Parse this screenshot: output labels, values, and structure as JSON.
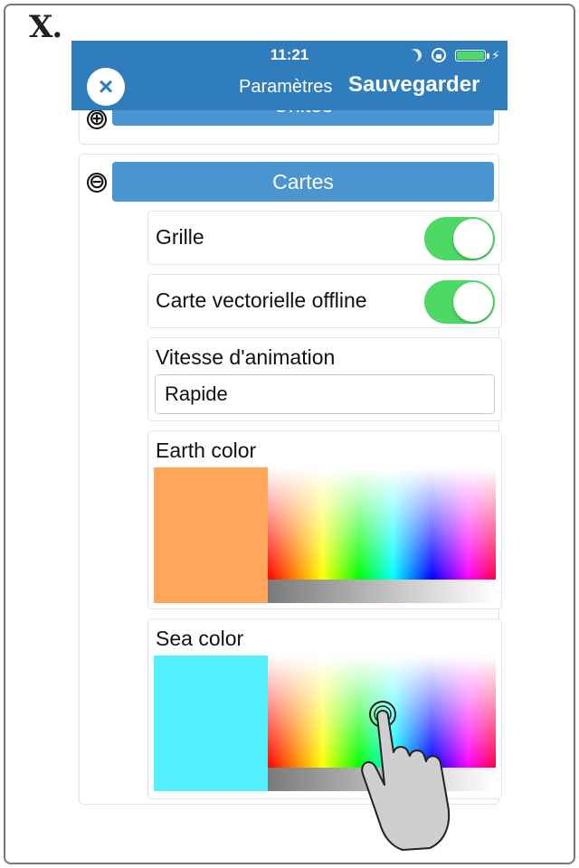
{
  "step_label": "X.",
  "status_bar": {
    "time": "11:21"
  },
  "nav": {
    "title": "Paramètres",
    "save_label": "Sauvegarder",
    "close_icon": "×"
  },
  "sections": {
    "units": {
      "title": "Unités",
      "icon": "⊕"
    },
    "maps": {
      "title": "Cartes",
      "icon": "⊖"
    }
  },
  "maps": {
    "grid": {
      "label": "Grille",
      "enabled": true
    },
    "offline_vector_map": {
      "label": "Carte vectorielle offline",
      "enabled": true
    },
    "animation_speed": {
      "label": "Vitesse d'animation",
      "value": "Rapide"
    },
    "earth_color": {
      "label": "Earth color",
      "color": "#ffa65a"
    },
    "sea_color": {
      "label": "Sea color",
      "color": "#55f0ff"
    }
  },
  "colors": {
    "navbar": "#2f7dbd",
    "section_header": "#4a95cf",
    "switch_on": "#4cd964"
  }
}
